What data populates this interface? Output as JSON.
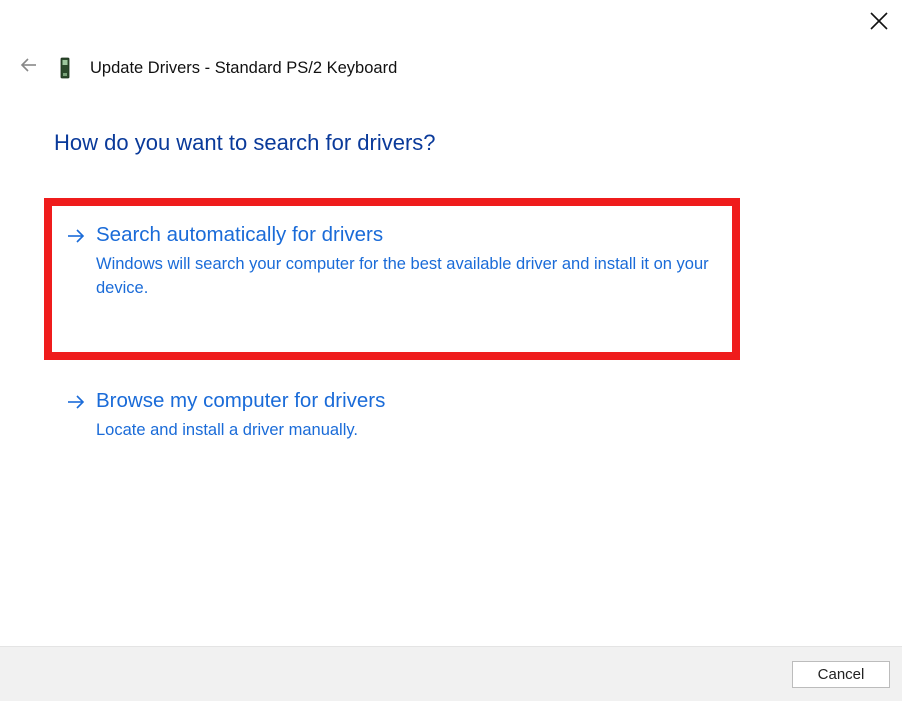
{
  "window": {
    "title": "Update Drivers - Standard PS/2 Keyboard"
  },
  "question": "How do you want to search for drivers?",
  "options": [
    {
      "title": "Search automatically for drivers",
      "description": "Windows will search your computer for the best available driver and install it on your device."
    },
    {
      "title": "Browse my computer for drivers",
      "description": "Locate and install a driver manually."
    }
  ],
  "buttons": {
    "cancel": "Cancel"
  }
}
